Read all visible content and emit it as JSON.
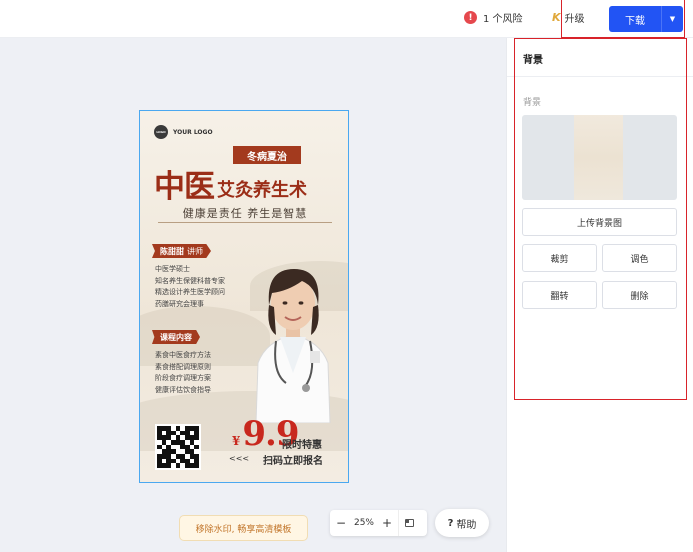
{
  "topbar": {
    "risk_icon": "!",
    "risk_label": "1 个风险",
    "upgrade_icon": "K",
    "upgrade_label": "升级",
    "download_label": "下载",
    "download_caret": "▼"
  },
  "poster": {
    "logo_mark": "LOGO",
    "logo_text": "YOUR LOGO",
    "ribbon": "冬病夏治",
    "title_main": "中医",
    "title_sub": "艾灸养生术",
    "slogan": "健康是责任  养生是智慧",
    "teacher_name": "陈甜甜",
    "teacher_role": "讲师",
    "teacher_lines": [
      "中医学硕士",
      "知名养生保健科普专家",
      "精选设计养生医学顾问",
      "药膳研究会理事"
    ],
    "course_label": "课程内容",
    "course_lines": [
      "素食中医食疗方法",
      "素食搭配调理原则",
      "阶段食疗调理方案",
      "健康评估饮食指导"
    ],
    "price_symbol": "¥",
    "price_value": "9.9",
    "price_note": "限时特惠",
    "arrows": "<<<",
    "scan_label": "扫码立即报名"
  },
  "canvas_controls": {
    "watermark_label": "移除水印, 畅享高清模板",
    "zoom_minus": "−",
    "zoom_value": "25%",
    "zoom_plus": "+",
    "help_icon": "?",
    "help_label": "帮助"
  },
  "panel": {
    "title": "背景",
    "section_label": "背景",
    "upload_label": "上传背景图",
    "crop_label": "裁剪",
    "adjust_color_label": "调色",
    "flip_label": "翻转",
    "delete_label": "删除"
  },
  "colors": {
    "accent": "#2254f4",
    "highlight": "#d8232a",
    "poster_red": "#a33a1e"
  },
  "icons": {
    "risk": "warning-circle-icon",
    "upgrade": "upgrade-k-icon",
    "fit": "fit-screen-icon",
    "help": "question-icon"
  }
}
